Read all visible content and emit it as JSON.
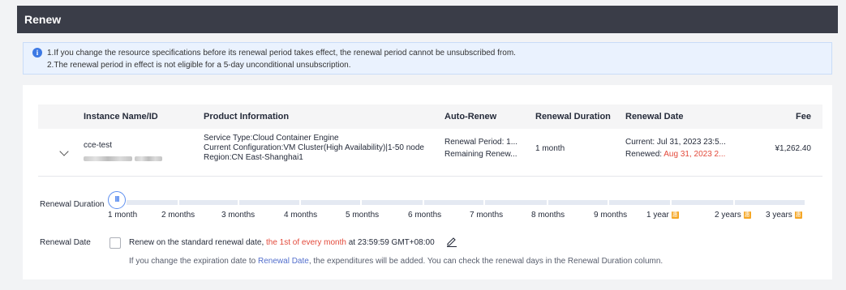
{
  "header": {
    "title": "Renew"
  },
  "notice": {
    "line1": "1.If you change the resource specifications before its renewal period takes effect, the renewal period cannot be unsubscribed from.",
    "line2": "2.The renewal period in effect is not eligible for a 5-day unconditional unsubscription."
  },
  "table": {
    "headers": {
      "name": "Instance Name/ID",
      "product": "Product Information",
      "auto_renew": "Auto-Renew",
      "duration": "Renewal Duration",
      "date": "Renewal Date",
      "fee": "Fee"
    },
    "row": {
      "name": "cce-test",
      "product_line1": "Service Type:Cloud Container Engine",
      "product_line2": "Current Configuration:VM Cluster(High Availability)|1-50 node",
      "product_line3": "Region:CN East-Shanghai1",
      "auto_renew_line1": "Renewal Period: 1...",
      "auto_renew_line2": "Remaining Renew...",
      "duration": "1 month",
      "date_current": "Current: Jul 31, 2023 23:5...",
      "date_renewed_label": "Renewed: ",
      "date_renewed_value": "Aug 31, 2023 2...",
      "fee": "¥1,262.40"
    }
  },
  "duration_slider": {
    "label": "Renewal Duration",
    "handle_glyph": "III",
    "selected_index": 0,
    "ticks": [
      "1 month",
      "2 months",
      "3 months",
      "4 months",
      "5 months",
      "6 months",
      "7 months",
      "8 months",
      "9 months",
      "1 year",
      "2 years",
      "3 years"
    ],
    "discount_badge": "惠"
  },
  "renewal_date": {
    "label": "Renewal Date",
    "checkbox_checked": false,
    "text_before": "Renew on the standard renewal date, ",
    "text_highlight": "the 1st of every month",
    "text_after": " at 23:59:59 GMT+08:00",
    "hint_before": "If you change the expiration date to ",
    "hint_link": "Renewal Date",
    "hint_after": ", the expenditures will be added. You can check the renewal days in the Renewal Duration column."
  },
  "colors": {
    "accent": "#526ecc",
    "highlight_red": "#e34a3b",
    "header_bar": "#3a3d48",
    "notice_bg": "#eaf2fe",
    "badge": "#f5a623"
  }
}
